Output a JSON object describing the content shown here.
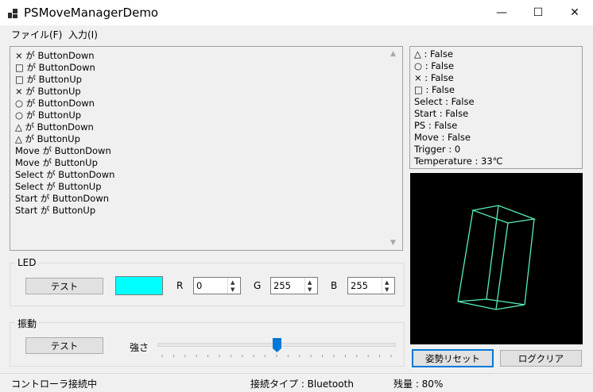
{
  "window": {
    "title": "PSMoveManagerDemo",
    "minimize": "—",
    "maximize": "☐",
    "close": "✕"
  },
  "menu": [
    {
      "label": "ファイル(F)"
    },
    {
      "label": "入力(I)"
    }
  ],
  "log": {
    "lines": [
      "× が ButtonDown",
      "□ が ButtonDown",
      "□ が ButtonUp",
      "× が ButtonUp",
      "○ が ButtonDown",
      "○ が ButtonUp",
      "△ が ButtonDown",
      "△ が ButtonUp",
      "Move が ButtonDown",
      "Move が ButtonUp",
      "Select が ButtonDown",
      "Select が ButtonUp",
      "Start が ButtonDown",
      "Start が ButtonUp"
    ]
  },
  "status": {
    "lines": [
      "△ : False",
      "○ : False",
      "× : False",
      "□ : False",
      "Select : False",
      "Start : False",
      "PS : False",
      "Move : False",
      "Trigger : 0",
      "Temperature : 33℃"
    ]
  },
  "led": {
    "group_title": "LED",
    "test_button": "テスト",
    "color": "#00ffff",
    "r_label": "R",
    "r_value": "0",
    "g_label": "G",
    "g_value": "255",
    "b_label": "B",
    "b_value": "255"
  },
  "vibration": {
    "group_title": "振動",
    "test_button": "テスト",
    "strength_label": "強さ",
    "slider_value": 0.5,
    "tick_count": 21
  },
  "buttons": {
    "reset_pose": "姿勢リセット",
    "clear_log": "ログクリア"
  },
  "statusbar": {
    "connection": "コントローラ接続中",
    "connection_type": "接続タイプ : Bluetooth",
    "battery": "残量 : 80%"
  },
  "colors": {
    "wireframe": "#55f0b4",
    "viewport_bg": "#000000",
    "slider_thumb": "#0078d7"
  }
}
